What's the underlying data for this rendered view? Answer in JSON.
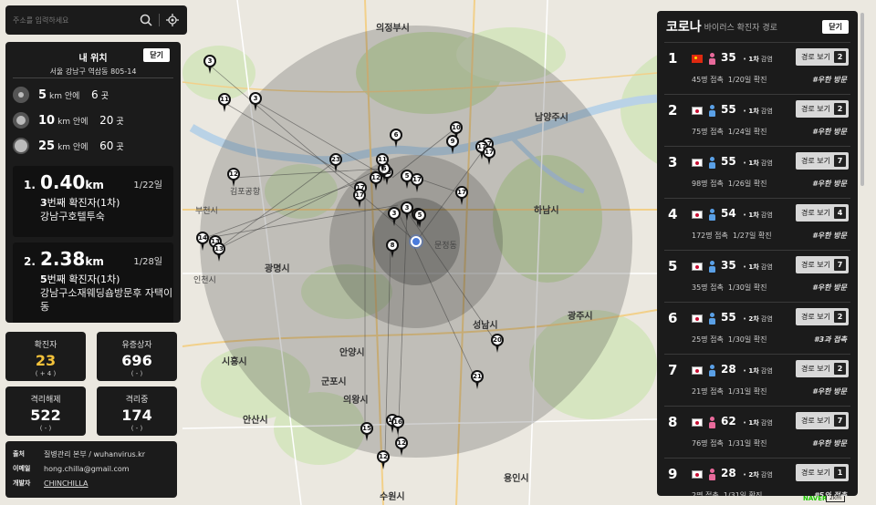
{
  "search": {
    "placeholder": "주소를 입력하세요"
  },
  "my_location": {
    "title": "내 위치",
    "address": "서울 강남구 역삼동 805-14",
    "close_label": "닫기",
    "radii": [
      {
        "km": "5",
        "unit": "km 안에",
        "count": "6",
        "suffix": "곳"
      },
      {
        "km": "10",
        "unit": "km 안에",
        "count": "20",
        "suffix": "곳"
      },
      {
        "km": "25",
        "unit": "km 안에",
        "count": "60",
        "suffix": "곳"
      }
    ],
    "nearby": [
      {
        "num": "1.",
        "distance": "0.40",
        "unit": "km",
        "date": "1/22일",
        "case_no": "3",
        "case_label": "번째 확진자(1차)",
        "place": "강남구호텔투숙"
      },
      {
        "num": "2.",
        "distance": "2.38",
        "unit": "km",
        "date": "1/28일",
        "case_no": "5",
        "case_label": "번째 확진자(1차)",
        "place": "강남구소재웨딩숍방문후 자택이동"
      }
    ]
  },
  "stats": [
    {
      "label": "확진자",
      "value": "23",
      "delta": "( + 4 )",
      "color": "#f4c23a"
    },
    {
      "label": "유증상자",
      "value": "696",
      "delta": "( - )",
      "color": "#ffffff"
    },
    {
      "label": "격리해제",
      "value": "522",
      "delta": "( - )",
      "color": "#ffffff"
    },
    {
      "label": "격리중",
      "value": "174",
      "delta": "( - )",
      "color": "#ffffff"
    }
  ],
  "info": {
    "source_key": "출처",
    "source_val": "질병관리 본부 / wuhanvirus.kr",
    "email_key": "이메일",
    "email_val": "hong.chilla@gmail.com",
    "dev_key": "개발자",
    "dev_val": "CHINCHILLA"
  },
  "panel": {
    "title": "코로나",
    "subtitle": "바이러스 확진자 경로",
    "close_label": "닫기",
    "route_label": "경로 보기",
    "cases": [
      {
        "no": "1",
        "nation": "cn",
        "gender": "female",
        "age": "35",
        "stage": "1차",
        "stage_suffix": "감염",
        "contacts": "45명 접촉",
        "date": "1/20일 확진",
        "routes": "2",
        "tag": "#우한 방문"
      },
      {
        "no": "2",
        "nation": "kr",
        "gender": "male",
        "age": "55",
        "stage": "1차",
        "stage_suffix": "감염",
        "contacts": "75명 접촉",
        "date": "1/24일 확진",
        "routes": "2",
        "tag": "#우한 방문"
      },
      {
        "no": "3",
        "nation": "kr",
        "gender": "male",
        "age": "55",
        "stage": "1차",
        "stage_suffix": "감염",
        "contacts": "98명 접촉",
        "date": "1/26일 확진",
        "routes": "7",
        "tag": "#우한 방문"
      },
      {
        "no": "4",
        "nation": "kr",
        "gender": "male",
        "age": "54",
        "stage": "1차",
        "stage_suffix": "감염",
        "contacts": "172명 접촉",
        "date": "1/27일 확진",
        "routes": "4",
        "tag": "#우한 방문"
      },
      {
        "no": "5",
        "nation": "kr",
        "gender": "male",
        "age": "35",
        "stage": "1차",
        "stage_suffix": "감염",
        "contacts": "35명 접촉",
        "date": "1/30일 확진",
        "routes": "7",
        "tag": "#우한 방문"
      },
      {
        "no": "6",
        "nation": "kr",
        "gender": "male",
        "age": "55",
        "stage": "2차",
        "stage_suffix": "감염",
        "contacts": "25명 접촉",
        "date": "1/30일 확진",
        "routes": "2",
        "tag": "#3과 접촉"
      },
      {
        "no": "7",
        "nation": "kr",
        "gender": "male",
        "age": "28",
        "stage": "1차",
        "stage_suffix": "감염",
        "contacts": "21명 접촉",
        "date": "1/31일 확진",
        "routes": "2",
        "tag": "#우한 방문"
      },
      {
        "no": "8",
        "nation": "kr",
        "gender": "female",
        "age": "62",
        "stage": "1차",
        "stage_suffix": "감염",
        "contacts": "76명 접촉",
        "date": "1/31일 확진",
        "routes": "7",
        "tag": "#우한 방문"
      },
      {
        "no": "9",
        "nation": "kr",
        "gender": "female",
        "age": "28",
        "stage": "2차",
        "stage_suffix": "감염",
        "contacts": "2명 접촉",
        "date": "1/31일 확진",
        "routes": "1",
        "tag": "#5와 접촉"
      }
    ]
  },
  "map": {
    "places": [
      "의정부시",
      "남양주시",
      "하남시",
      "광명시",
      "성남시",
      "광주시",
      "시흥시",
      "안양시",
      "군포시",
      "의왕시",
      "안산시",
      "용인시",
      "수원시",
      "부천시",
      "김포공항",
      "문정동",
      "인천시"
    ],
    "markers": [
      "3",
      "11",
      "3",
      "10",
      "6",
      "9",
      "17",
      "17",
      "17",
      "23",
      "12",
      "17",
      "13",
      "12",
      "6",
      "5",
      "17",
      "11",
      "17",
      "3",
      "3",
      "3",
      "5",
      "17",
      "8",
      "14",
      "13",
      "13",
      "20",
      "21",
      "16",
      "15",
      "12",
      "12",
      "16"
    ],
    "brand": "NAVER",
    "scale": "2km"
  },
  "colors": {
    "panel": "#1b1b1b",
    "highlight": "#f4c23a",
    "female": "#e86a9b",
    "male": "#5aa0e6"
  }
}
